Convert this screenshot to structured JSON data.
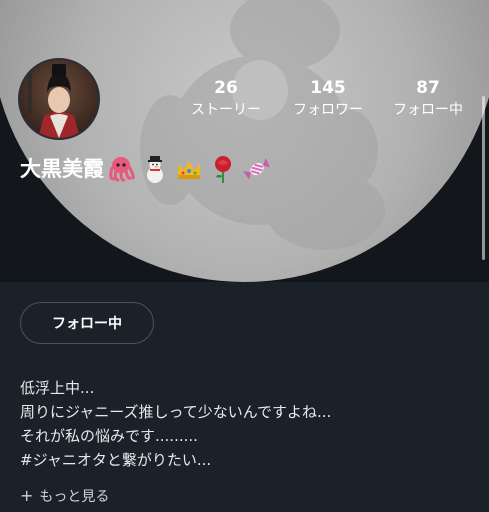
{
  "profile": {
    "name": "大黒美霞",
    "emojis": [
      "octopus-emoji",
      "snowman-emoji",
      "crown-emoji",
      "rose-emoji",
      "candy-emoji"
    ],
    "stats": [
      {
        "value": "26",
        "label": "ストーリー"
      },
      {
        "value": "145",
        "label": "フォロワー"
      },
      {
        "value": "87",
        "label": "フォロー中"
      }
    ],
    "follow_button_label": "フォロー中"
  },
  "bio": {
    "lines": [
      "低浮上中...",
      "周りにジャニーズ推しって少ないんですよね...",
      "それが私の悩みです.........",
      "#ジャニオタと繋がりたい..."
    ],
    "more_label": "もっと見る",
    "more_icon": "+"
  },
  "colors": {
    "background": "#1b2129",
    "header_background": "#13171c",
    "cover": "#b2b2b2",
    "text": "#ffffff",
    "button_border": "#4a525d"
  }
}
